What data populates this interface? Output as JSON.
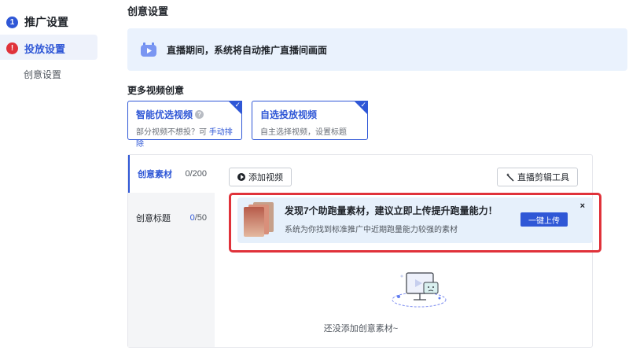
{
  "sidebar": {
    "step1": {
      "number": "1",
      "title": "推广设置"
    },
    "step2": {
      "number": "!",
      "title": "投放设置"
    },
    "sub_item": "创意设置"
  },
  "main": {
    "page_title": "创意设置",
    "banner": {
      "text": "直播期间，系统将自动推广直播间画面"
    },
    "more_creative_label": "更多视频创意",
    "options": [
      {
        "title": "智能优选视频",
        "desc": "部分视频不想投？可",
        "link": "手动排除",
        "checked": true
      },
      {
        "title": "自选投放视频",
        "desc": "自主选择视频，设置标题",
        "checked": true
      }
    ],
    "panel": {
      "tabs": [
        {
          "label": "创意素材",
          "count": "0/200"
        },
        {
          "label": "创意标题",
          "count_current": "0",
          "count_total": "/50"
        }
      ],
      "add_video_button": "添加视频",
      "live_edit_tool_button": "直播剪辑工具",
      "promo": {
        "title": "发现7个助跑量素材，建议立即上传提升跑量能力！",
        "desc": "系统为你找到标准推广中近期跑量能力较强的素材",
        "button": "一键上传",
        "close": "×"
      },
      "empty_text": "还没添加创意素材~"
    }
  },
  "colors": {
    "accent": "#2f57d6",
    "warning": "#e0323a",
    "banner_bg": "#eaf2fd"
  }
}
